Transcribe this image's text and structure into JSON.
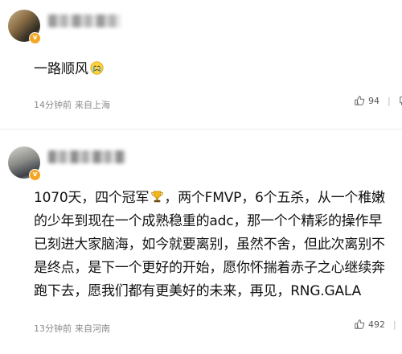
{
  "comments": [
    {
      "text": "一路顺风",
      "emoji": "crying-face-icon",
      "meta": {
        "time": "14分钟前",
        "location": "来自上海"
      },
      "likes": "94"
    },
    {
      "text_segments": [
        "1070天，四个冠军",
        "，两个FMVP，6个五杀，从一个稚嫩的少年到现在一个成熟稳重的adc，那一个个精彩的操作早已刻进大家脑海，如今就要离别，虽然不舍，但此次离别不是终点，是下一个更好的开始，愿你怀揣着赤子之心继续奔跑下去，愿我们都有更美好的未来，再见，RNG.GALA"
      ],
      "emoji": "trophy-icon",
      "meta": {
        "time": "13分钟前",
        "location": "来自河南"
      },
      "likes": "492"
    }
  ],
  "colors": {
    "badge": "#f5a623",
    "meta_text": "#8a8a8a",
    "divider": "#ececec"
  }
}
